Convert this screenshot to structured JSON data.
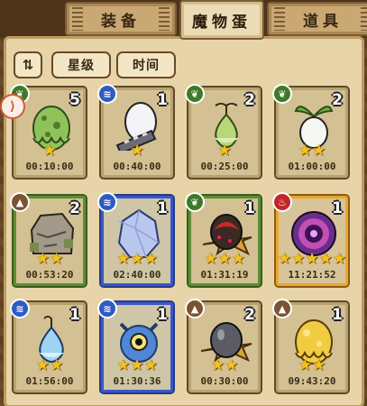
{
  "tabs": [
    {
      "label": "装备",
      "active": false
    },
    {
      "label": "魔物蛋",
      "active": true
    },
    {
      "label": "道具",
      "active": false
    }
  ],
  "toolbar": {
    "sort_icon": "sort-icon",
    "star_filter_label": "星级",
    "time_filter_label": "时间"
  },
  "eggs": [
    {
      "element": "grass",
      "count": "5",
      "stars": 1,
      "time": "00:10:00",
      "border": "none",
      "egg": "green-slime-egg"
    },
    {
      "element": "water",
      "count": "1",
      "stars": 1,
      "time": "00:40:00",
      "border": "none",
      "egg": "striped-white-egg"
    },
    {
      "element": "grass",
      "count": "2",
      "stars": 1,
      "time": "00:25:00",
      "border": "none",
      "egg": "sprout-egg"
    },
    {
      "element": "grass",
      "count": "2",
      "stars": 2,
      "time": "01:00:00",
      "border": "none",
      "egg": "radish-egg"
    },
    {
      "element": "earth",
      "count": "2",
      "stars": 2,
      "time": "00:53:20",
      "border": "green",
      "egg": "rock-egg"
    },
    {
      "element": "water",
      "count": "1",
      "stars": 3,
      "time": "02:40:00",
      "border": "blue",
      "egg": "crystal-egg"
    },
    {
      "element": "grass",
      "count": "1",
      "stars": 3,
      "time": "01:31:19",
      "border": "green",
      "egg": "strawberry-egg"
    },
    {
      "element": "fire",
      "count": "1",
      "stars": 5,
      "time": "11:21:52",
      "border": "gold",
      "egg": "vortex-egg"
    },
    {
      "element": "water",
      "count": "1",
      "stars": 2,
      "time": "01:56:00",
      "border": "none",
      "egg": "droplet-egg"
    },
    {
      "element": "water",
      "count": "1",
      "stars": 3,
      "time": "01:30:36",
      "border": "blue",
      "egg": "eye-egg"
    },
    {
      "element": "earth",
      "count": "2",
      "stars": 2,
      "time": "00:30:00",
      "border": "none",
      "egg": "pebble-egg"
    },
    {
      "element": "earth",
      "count": "1",
      "stars": 2,
      "time": "09:43:20",
      "border": "none",
      "egg": "golden-slime-egg"
    }
  ]
}
